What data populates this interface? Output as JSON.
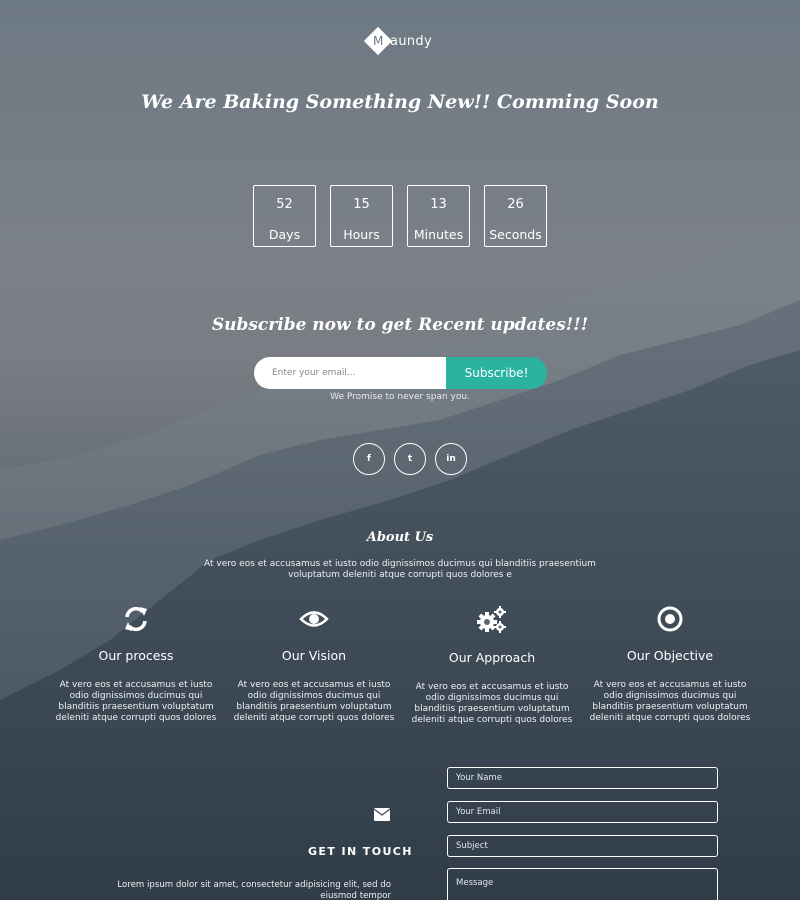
{
  "brand": {
    "logo_letter": "M",
    "name_rest": "aundy"
  },
  "headline": "We Are Baking Something New!! Comming Soon",
  "countdown": [
    {
      "value": "52",
      "label": "Days"
    },
    {
      "value": "15",
      "label": "Hours"
    },
    {
      "value": "13",
      "label": "Minutes"
    },
    {
      "value": "26",
      "label": "Seconds"
    }
  ],
  "subscribe": {
    "title": "Subscribe now to get Recent updates!!!",
    "placeholder": "Enter your email...",
    "button": "Subscribe!",
    "note": "We Promise to never span you."
  },
  "social": [
    {
      "icon": "facebook-icon",
      "glyph": "f"
    },
    {
      "icon": "twitter-icon",
      "glyph": "t"
    },
    {
      "icon": "linkedin-icon",
      "glyph": "in"
    }
  ],
  "about": {
    "title": "About Us",
    "text": "At vero eos et accusamus et iusto odio dignissimos ducimus qui blanditiis praesentium voluptatum deleniti atque corrupti quos dolores e"
  },
  "features": [
    {
      "icon": "refresh-icon",
      "title": "Our process",
      "text": "At vero eos et accusamus et iusto odio dignissimos ducimus qui blanditiis praesentium voluptatum deleniti atque corrupti quos dolores"
    },
    {
      "icon": "eye-icon",
      "title": "Our Vision",
      "text": "At vero eos et accusamus et iusto odio dignissimos ducimus qui blanditiis praesentium voluptatum deleniti atque corrupti quos dolores"
    },
    {
      "icon": "gears-icon",
      "title": "Our Approach",
      "text": "At vero eos et accusamus et iusto odio dignissimos ducimus qui blanditiis praesentium voluptatum deleniti atque corrupti quos dolores"
    },
    {
      "icon": "target-icon",
      "title": "Our Objective",
      "text": "At vero eos et accusamus et iusto odio dignissimos ducimus qui blanditiis praesentium voluptatum deleniti atque corrupti quos dolores"
    }
  ],
  "contact": {
    "title": "GET IN TOUCH",
    "text": "Lorem ipsum dolor sit amet, consectetur adipisicing elit, sed do eiusmod tempor",
    "fields": {
      "name": "Your Name",
      "email": "Your Email",
      "subject": "Subject",
      "message": "Message"
    }
  },
  "colors": {
    "accent": "#2bb3a0",
    "text": "#ffffff"
  }
}
